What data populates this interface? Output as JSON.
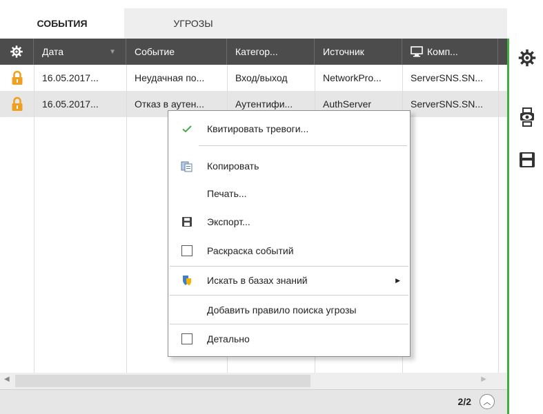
{
  "tabs": [
    {
      "label": "СОБЫТИЯ",
      "active": true
    },
    {
      "label": "УГРОЗЫ",
      "active": false
    }
  ],
  "table": {
    "columns": [
      "Дата",
      "Событие",
      "Категор...",
      "Источник",
      "Комп..."
    ],
    "rows": [
      {
        "status_icon": "lock-icon",
        "cells": [
          "16.05.2017...",
          "Неудачная по...",
          "Вход/выход",
          "NetworkPro...",
          "ServerSNS.SN..."
        ]
      },
      {
        "status_icon": "lock-icon",
        "cells": [
          "16.05.2017...",
          "Отказ в аутен...",
          "Аутентифи...",
          "AuthServer",
          "ServerSNS.SN..."
        ]
      }
    ]
  },
  "pager": {
    "text": "2/2"
  },
  "context_menu": {
    "items": [
      {
        "label": "Квитировать тревоги...",
        "icon": "check-icon"
      },
      {
        "label": "Копировать",
        "icon": "copy-icon"
      },
      {
        "label": "Печать...",
        "icon": ""
      },
      {
        "label": "Экспорт...",
        "icon": "save-icon"
      },
      {
        "label": "Раскраска событий",
        "icon": "checkbox",
        "checked": false
      },
      {
        "label": "Искать в базах знаний",
        "icon": "shield-icon",
        "submenu": true
      },
      {
        "label": "Добавить правило поиска угрозы",
        "icon": ""
      },
      {
        "label": "Детально",
        "icon": "checkbox",
        "checked": false
      }
    ]
  },
  "colors": {
    "header_bg": "#4c4c4c",
    "accent_green": "#3fae3f",
    "lock_orange": "#f0a020",
    "selected_row": "#e6e6e6"
  }
}
